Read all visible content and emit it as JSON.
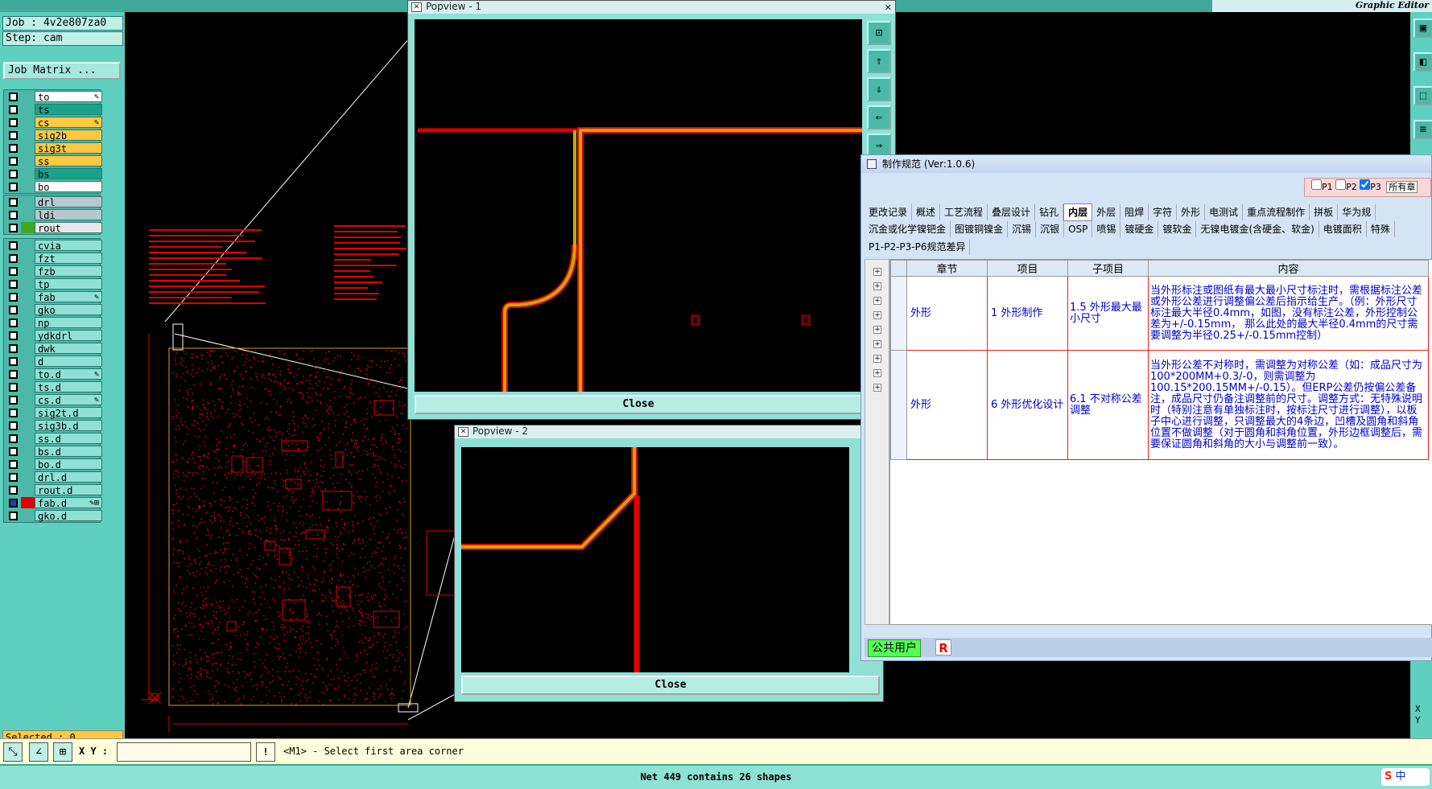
{
  "app": {
    "right_title": "Graphic Editor"
  },
  "left_panel": {
    "job": "Job : 4v2e807za0",
    "step": "Step: cam",
    "job_matrix_button": "Job Matrix ...",
    "selected": "Selected : 0",
    "groups": [
      [
        {
          "name": "to",
          "bg": "#ffffff",
          "mark": "✎"
        },
        {
          "name": "ts",
          "bg": "#1aa38a",
          "mark": ""
        },
        {
          "name": "cs",
          "bg": "#ffc840",
          "mark": "✎"
        },
        {
          "name": "sig2b",
          "bg": "#ffc840",
          "mark": ""
        },
        {
          "name": "sig3t",
          "bg": "#ffc840",
          "mark": ""
        },
        {
          "name": "ss",
          "bg": "#ffc840",
          "mark": ""
        },
        {
          "name": "bs",
          "bg": "#1aa38a",
          "mark": ""
        },
        {
          "name": "bo",
          "bg": "#ffffff",
          "mark": ""
        }
      ],
      [
        {
          "name": "drl",
          "bg": "#b8c8d0",
          "mark": ""
        },
        {
          "name": "ldi",
          "bg": "#b8c8d0",
          "mark": ""
        },
        {
          "name": "rout",
          "bg": "#e8e8e8",
          "mark": "",
          "color": "#3fa820"
        }
      ],
      [
        {
          "name": "cvia",
          "bg": "#8fe0d5",
          "mark": ""
        },
        {
          "name": "fzt",
          "bg": "#8fe0d5",
          "mark": ""
        },
        {
          "name": "fzb",
          "bg": "#8fe0d5",
          "mark": ""
        },
        {
          "name": "tp",
          "bg": "#8fe0d5",
          "mark": ""
        },
        {
          "name": "fab",
          "bg": "#8fe0d5",
          "mark": "✎"
        },
        {
          "name": "gko",
          "bg": "#8fe0d5",
          "mark": ""
        },
        {
          "name": "np",
          "bg": "#8fe0d5",
          "mark": ""
        },
        {
          "name": "ydkdrl",
          "bg": "#8fe0d5",
          "mark": ""
        },
        {
          "name": "dwk",
          "bg": "#8fe0d5",
          "mark": ""
        },
        {
          "name": "d",
          "bg": "#8fe0d5",
          "mark": ""
        },
        {
          "name": "to.d",
          "bg": "#8fe0d5",
          "mark": "✎"
        },
        {
          "name": "ts.d",
          "bg": "#8fe0d5",
          "mark": ""
        },
        {
          "name": "cs.d",
          "bg": "#8fe0d5",
          "mark": "✎"
        },
        {
          "name": "sig2t.d",
          "bg": "#8fe0d5",
          "mark": ""
        },
        {
          "name": "sig3b.d",
          "bg": "#8fe0d5",
          "mark": ""
        },
        {
          "name": "ss.d",
          "bg": "#8fe0d5",
          "mark": ""
        },
        {
          "name": "bs.d",
          "bg": "#8fe0d5",
          "mark": ""
        },
        {
          "name": "bo.d",
          "bg": "#8fe0d5",
          "mark": ""
        },
        {
          "name": "drl.d",
          "bg": "#8fe0d5",
          "mark": ""
        },
        {
          "name": "rout.d",
          "bg": "#8fe0d5",
          "mark": ""
        },
        {
          "name": "fab.d",
          "bg": "#8fe0d5",
          "mark": "✎⊞",
          "color": "#e00000",
          "checked": true
        },
        {
          "name": "gko.d",
          "bg": "#8fe0d5",
          "mark": ""
        }
      ]
    ]
  },
  "command_bar": {
    "xy_label": "X Y :",
    "xy_value": "",
    "message": "<M1> - Select first area corner"
  },
  "status": "Net 449 contains 26 shapes",
  "xy_readout": [
    "X",
    "Y"
  ],
  "popview1": {
    "title": "Popview - 1",
    "close": "Close"
  },
  "popview2": {
    "title": "Popview - 2",
    "close": "Close"
  },
  "spec_window": {
    "title": "制作规范 (Ver:1.0.6)",
    "filter": {
      "p1": "P1",
      "p2": "P2",
      "p3": "P3",
      "select": "所有章"
    },
    "tabs_row1": [
      "更改记录",
      "概述",
      "工艺流程",
      "叠层设计",
      "钻孔",
      "内层",
      "外层",
      "阻焊",
      "字符",
      "外形",
      "电测试",
      "重点流程制作",
      "拼板",
      "华为规"
    ],
    "active_tab": "内层",
    "tabs_row2": [
      "沉金或化学镍钯金",
      "图镀铜镍金",
      "沉锡",
      "沉银",
      "OSP",
      "喷锡",
      "镀硬金",
      "镀软金",
      "无镍电镀金(含硬金、软金)",
      "电镀面积",
      "特殊"
    ],
    "tabs_row3": [
      "P1-P2-P3-P6规范差异"
    ],
    "columns": [
      "章节",
      "项目",
      "子项目",
      "内容"
    ],
    "rows": [
      {
        "chapter": "外形",
        "item": "1 外形制作",
        "sub": "1.5 外形最大最小尺寸",
        "content": "当外形标注或图纸有最大最小尺寸标注时，需根据标注公差或外形公差进行调整偏公差后指示给生产。（例：外形尺寸标注最大半径0.4mm，如图，没有标注公差，外形控制公差为+/-0.15mm， 那么此处的最大半径0.4mm的尺寸需要调整为半径0.25+/-0.15mm控制）"
      },
      {
        "chapter": "外形",
        "item": "6 外形优化设计",
        "sub": "6.1 不对称公差调整",
        "content": "当外形公差不对称时，需调整为对称公差（如：成品尺寸为100*200MM+0.3/-0，则需调整为100.15*200.15MM+/-0.15）。但ERP公差仍按偏公差备注，成品尺寸仍备注调整前的尺寸。调整方式：无特殊说明时（特别注意有单独标注时，按标注尺寸进行调整），以板子中心进行调整，只调整最大的4条边，凹槽及圆角和斜角位置不做调整（对于圆角和斜角位置，外形边框调整后，需要保证圆角和斜角的大小与调整前一致）。"
      }
    ],
    "footer": {
      "user": "公共用户",
      "r": "R"
    }
  },
  "ime": {
    "s": "S",
    "lang": "中"
  }
}
